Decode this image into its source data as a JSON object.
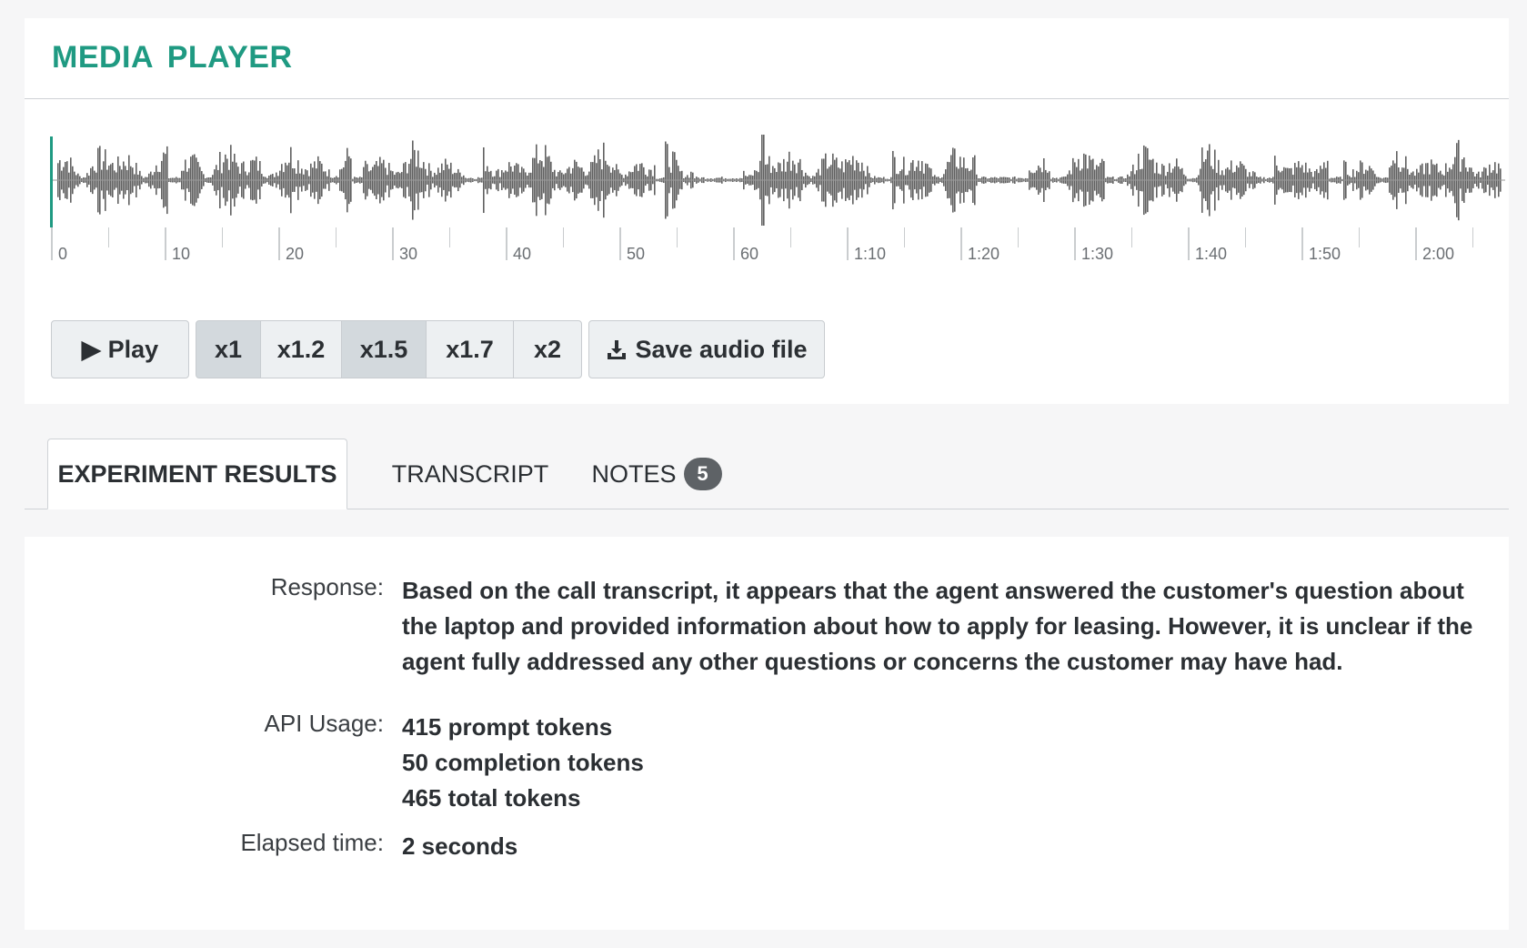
{
  "media_player": {
    "title": "MEDIA PLAYER",
    "time_ticks": [
      "0",
      "10",
      "20",
      "30",
      "40",
      "50",
      "60",
      "1:10",
      "1:20",
      "1:30",
      "1:40",
      "1:50",
      "2:00"
    ],
    "controls": {
      "play_label": "Play",
      "play_icon": "play-icon",
      "speeds": [
        "x1",
        "x1.2",
        "x1.5",
        "x1.7",
        "x2"
      ],
      "active_speeds": [
        "x1",
        "x1.5"
      ],
      "save_label": "Save audio file",
      "save_icon": "download-icon"
    },
    "colors": {
      "accent": "#1f9a82",
      "waveform": "#606060"
    }
  },
  "tabs": {
    "items": [
      {
        "label": "EXPERIMENT RESULTS",
        "active": true
      },
      {
        "label": "TRANSCRIPT",
        "active": false
      },
      {
        "label": "NOTES",
        "active": false,
        "badge": "5"
      }
    ]
  },
  "results": {
    "response_label": "Response:",
    "response_text": "Based on the call transcript, it appears that the agent answered the customer's question about the laptop and provided information about how to apply for leasing. However, it is unclear if the agent fully addressed any other questions or concerns the customer may have had.",
    "api_usage_label": "API Usage:",
    "api_usage_lines": [
      "415 prompt tokens",
      "50 completion tokens",
      "465 total tokens"
    ],
    "elapsed_label": "Elapsed time:",
    "elapsed_value": "2 seconds"
  }
}
